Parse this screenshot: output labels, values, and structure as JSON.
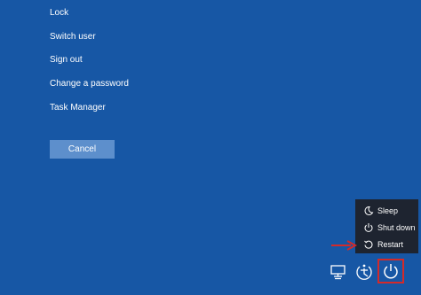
{
  "menu": {
    "items": [
      {
        "label": "Lock"
      },
      {
        "label": "Switch user"
      },
      {
        "label": "Sign out"
      },
      {
        "label": "Change a password"
      },
      {
        "label": "Task Manager"
      }
    ],
    "cancel_label": "Cancel"
  },
  "power_menu": {
    "options": [
      {
        "label": "Sleep",
        "icon": "moon-icon"
      },
      {
        "label": "Shut down",
        "icon": "power-icon"
      },
      {
        "label": "Restart",
        "icon": "restart-icon"
      }
    ]
  },
  "bottom_icons": [
    {
      "name": "network-icon"
    },
    {
      "name": "ease-of-access-icon"
    },
    {
      "name": "power-icon"
    }
  ],
  "colors": {
    "background": "#1757a5",
    "cancel_button": "#5d8fcc",
    "power_menu_bg": "#1e2430",
    "highlight": "#d32a2a"
  }
}
